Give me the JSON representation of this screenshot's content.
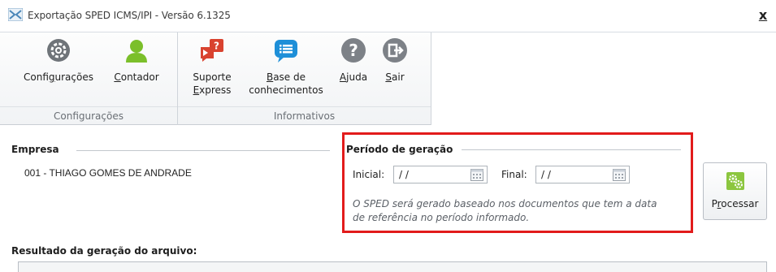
{
  "window": {
    "title": "Exportação SPED ICMS/IPI - Versão 6.1325",
    "close_label": "x"
  },
  "ribbon": {
    "groups": [
      {
        "label": "Configurações",
        "buttons": [
          {
            "label_pre": "Confi",
            "label_mnemonic": "g",
            "label_post": "urações",
            "icon": "gear-icon"
          },
          {
            "label_pre": "",
            "label_mnemonic": "C",
            "label_post": "ontador",
            "icon": "person-icon"
          }
        ]
      },
      {
        "label": "Informativos",
        "buttons": [
          {
            "line1": "Suporte",
            "line2_pre": "",
            "line2_mnemonic": "E",
            "line2_post": "xpress",
            "icon": "support-express-icon"
          },
          {
            "line1_pre": "",
            "line1_mnemonic": "B",
            "line1_post": "ase de",
            "line2": "conhecimentos",
            "icon": "knowledge-base-icon"
          },
          {
            "label_pre": "",
            "label_mnemonic": "A",
            "label_post": "juda",
            "icon": "help-icon"
          },
          {
            "label_pre": "",
            "label_mnemonic": "S",
            "label_post": "air",
            "icon": "exit-icon"
          }
        ]
      }
    ]
  },
  "empresa": {
    "title": "Empresa",
    "value": "001 - THIAGO GOMES DE ANDRADE"
  },
  "periodo": {
    "title": "Período de geração",
    "inicial_label": "Inicial:",
    "inicial_value": " / /",
    "final_label": "Final:",
    "final_value": " / /",
    "note_line1": "O SPED será gerado baseado nos documentos que tem a data",
    "note_line2": "de referência no período informado."
  },
  "processar": {
    "label_pre": "P",
    "label_mnemonic": "r",
    "label_post": "ocessar",
    "icon": "process-gears-icon"
  },
  "resultado": {
    "title": "Resultado da geração do arquivo:"
  },
  "colors": {
    "highlight": "#e21b1b",
    "gear_gray": "#6f7479",
    "person_green": "#7bbf2a",
    "support_red": "#d9422f",
    "kb_blue": "#1e8fd8",
    "help_gray": "#7d8187"
  }
}
